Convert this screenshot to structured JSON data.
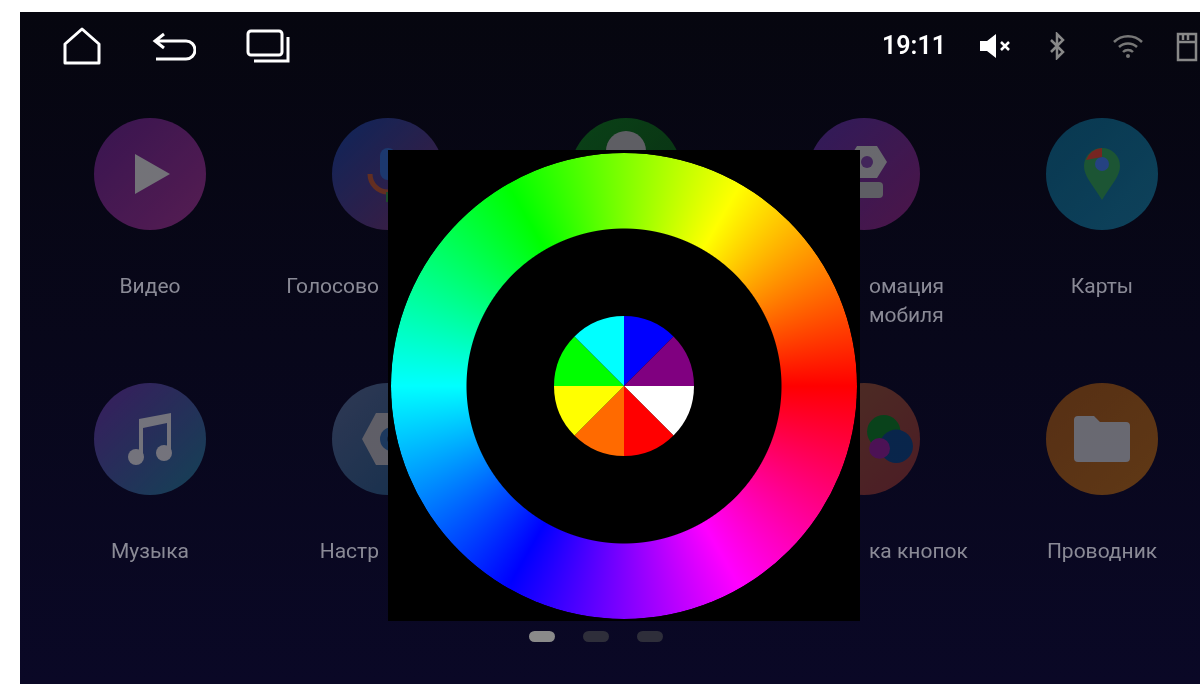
{
  "status_bar": {
    "time": "19:11",
    "muted": true
  },
  "apps": [
    {
      "kind": "video",
      "label_lines": [
        "Видео"
      ]
    },
    {
      "kind": "voice",
      "label_lines": [
        "Голосово"
      ]
    },
    {
      "kind": "chat"
    },
    {
      "kind": "car",
      "label_lines": [
        "омация",
        "мобиля"
      ]
    },
    {
      "kind": "maps",
      "label_lines": [
        "Карты"
      ]
    },
    {
      "kind": "music",
      "label_lines": [
        "Музыка"
      ]
    },
    {
      "kind": "settings",
      "label_lines": [
        "Настр"
      ]
    },
    {
      "kind": "hidden"
    },
    {
      "kind": "buttons",
      "label_lines": [
        "ка кнопок"
      ]
    },
    {
      "kind": "files",
      "label_lines": [
        "Проводник"
      ]
    }
  ],
  "pages": [
    {
      "selected": true
    },
    {
      "selected": false
    },
    {
      "selected": false
    }
  ]
}
